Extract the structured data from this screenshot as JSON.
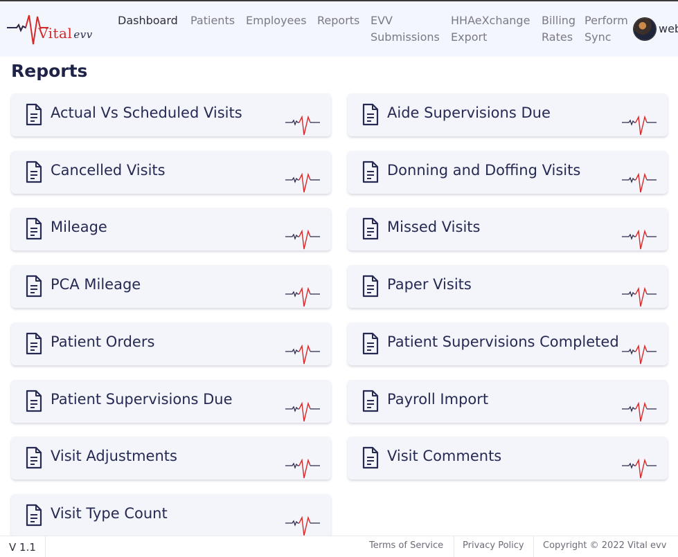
{
  "brand": {
    "name": "Vital",
    "suffix": "evv"
  },
  "nav": {
    "items": [
      {
        "label": "Dashboard",
        "active": true
      },
      {
        "label": "Patients"
      },
      {
        "label": "Employees"
      },
      {
        "label": "Reports"
      },
      {
        "label": "EVV\nSubmissions"
      },
      {
        "label": "HHAeXchange\nExport"
      },
      {
        "label": "Billing\nRates"
      },
      {
        "label": "Perform\nSync"
      }
    ],
    "user": "web"
  },
  "page": {
    "title": "Reports"
  },
  "reports": [
    "Actual Vs Scheduled Visits",
    "Aide Supervisions Due",
    "Cancelled Visits",
    "Donning and Doffing Visits",
    "Mileage",
    "Missed Visits",
    "PCA Mileage",
    "Paper Visits",
    "Patient Orders",
    "Patient Supervisions Completed",
    "Patient Supervisions Due",
    "Payroll Import",
    "Visit Adjustments",
    "Visit Comments",
    "Visit Type Count"
  ],
  "icons": {
    "card_icon": "document-icon",
    "card_accent": "pulse-icon"
  },
  "colors": {
    "accent_red": "#d62828",
    "text_navy": "#262a52",
    "card_bg": "#f3f5fb",
    "header_bg": "#f3f6fc"
  },
  "footer": {
    "version": "V 1.1",
    "terms": "Terms of Service",
    "privacy": "Privacy Policy",
    "copyright": "Copyright © 2022 Vital evv"
  }
}
